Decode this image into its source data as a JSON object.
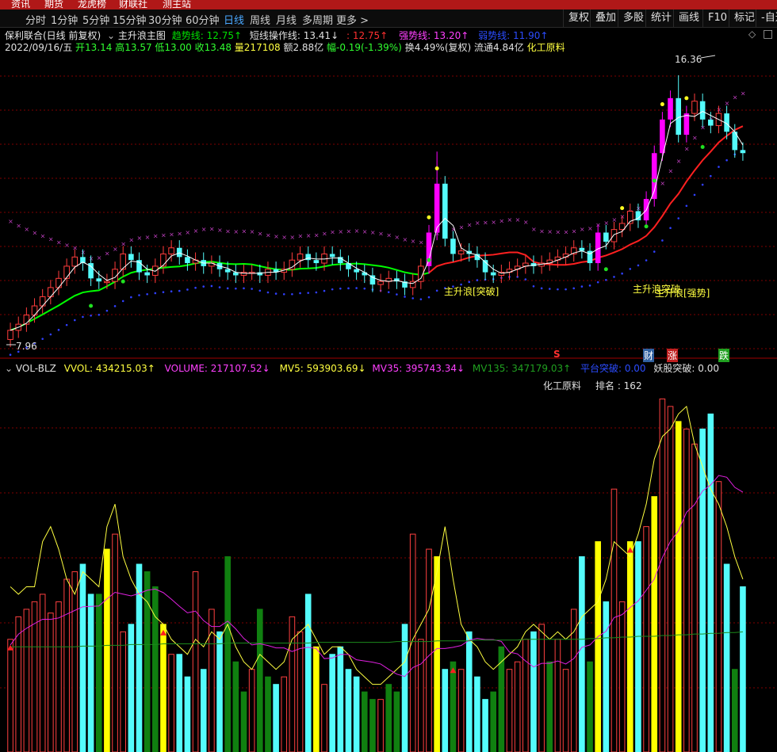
{
  "top_nav": [
    "资讯",
    "期货",
    "龙虎榜",
    "财联社",
    "测主站"
  ],
  "periods": [
    "分时",
    "1分钟",
    "5分钟",
    "15分钟",
    "30分钟",
    "60分钟",
    "日线",
    "周线",
    "月线",
    "多周期",
    "更多 >"
  ],
  "active_period": "日线",
  "right_tools": [
    "复权",
    "叠加",
    "多股",
    "统计",
    "画线",
    "F10",
    "标记",
    "-自选"
  ],
  "header": {
    "stock": "保利联合(日线 前复权)",
    "indicator": "主升浪主图",
    "trend_line": "趋势线: 12.75↑",
    "short_line": "短线操作线: 13.41↓",
    "short_val": ": 12.75↑",
    "strong_line": "强势线: 13.20↑",
    "weak_line": "弱势线: 11.90↑"
  },
  "quote": {
    "date": "2022/09/16/五",
    "open": "开13.14",
    "high": "高13.57",
    "low": "低13.00",
    "close": "收13.48",
    "volume": "量217108",
    "amount": "额2.88亿",
    "change": "幅-0.19(-1.39%)",
    "turnover": "换4.49%(复权)",
    "float": "流通4.84亿",
    "industry": "化工原料"
  },
  "price_annotations": {
    "high": "16.36",
    "low": "7.96",
    "breakout1": "主升浪[突破]",
    "breakout2": "主升浪突破",
    "strong": "主升浪[强势]",
    "mark_s": "S",
    "mark_cai": "财",
    "mark_zhang": "涨",
    "mark_die": "跌"
  },
  "volume_header": {
    "name": "VOL-BLZ",
    "vvol": "VVOL: 434215.03↑",
    "volume": "VOLUME: 217107.52↓",
    "mv5": "MV5: 593903.69↓",
    "mv35": "MV35: 395743.34↓",
    "mv135": "MV135: 347179.03↑",
    "platform": "平台突破: 0.00",
    "demon": "妖股突破: 0.00"
  },
  "sector": {
    "name": "化工原料",
    "rank": "排名 : 162"
  },
  "colors": {
    "up": "#ff3c3c",
    "down": "#54fcfc",
    "magenta": "#ff00ff",
    "yellow": "#ffff00",
    "trend_green": "#00ff00",
    "trend_red": "#ff2020",
    "grid": "#800000"
  },
  "chart_data": {
    "type": "candlestick",
    "ylim": [
      7.5,
      17.2
    ],
    "close": [
      8.1,
      8.3,
      8.6,
      8.9,
      9.2,
      9.5,
      9.8,
      10.2,
      10.5,
      10.3,
      9.8,
      9.7,
      9.7,
      10.1,
      10.6,
      10.4,
      10.0,
      9.9,
      10.2,
      10.6,
      10.8,
      10.5,
      10.3,
      10.4,
      10.2,
      10.3,
      10.1,
      10.0,
      9.9,
      10.0,
      10.0,
      9.9,
      10.1,
      10.0,
      10.1,
      10.4,
      10.6,
      10.4,
      10.3,
      10.6,
      10.5,
      10.3,
      10.1,
      10.0,
      9.9,
      9.6,
      9.7,
      9.8,
      9.7,
      9.5,
      9.7,
      10.2,
      11.3,
      12.9,
      11.1,
      10.6,
      10.7,
      10.6,
      10.4,
      10.0,
      9.9,
      10.0,
      10.1,
      10.2,
      10.3,
      10.2,
      10.3,
      10.4,
      10.5,
      10.6,
      10.8,
      10.7,
      10.3,
      11.3,
      11.0,
      11.4,
      11.6,
      12.0,
      11.7,
      12.4,
      13.9,
      15.0,
      15.7,
      14.5,
      15.2,
      15.6,
      15.0,
      14.8,
      15.2,
      14.6,
      14.0,
      13.9
    ],
    "volume": [
      150,
      180,
      190,
      200,
      210,
      185,
      200,
      230,
      240,
      250,
      210,
      210,
      270,
      290,
      160,
      170,
      250,
      240,
      220,
      170,
      130,
      130,
      100,
      240,
      110,
      190,
      160,
      260,
      120,
      80,
      110,
      190,
      100,
      90,
      100,
      180,
      160,
      210,
      140,
      90,
      130,
      140,
      110,
      100,
      80,
      70,
      70,
      90,
      80,
      170,
      290,
      150,
      270,
      260,
      110,
      120,
      110,
      160,
      100,
      70,
      80,
      140,
      110,
      120,
      150,
      160,
      170,
      120,
      150,
      110,
      190,
      260,
      120,
      280,
      200,
      350,
      200,
      280,
      280,
      300,
      340,
      470,
      460,
      440,
      430,
      410,
      430,
      450,
      360,
      250,
      110,
      220
    ],
    "vvol_line": [
      220,
      210,
      220,
      220,
      280,
      300,
      270,
      230,
      210,
      240,
      230,
      220,
      300,
      330,
      260,
      230,
      210,
      200,
      180,
      170,
      150,
      140,
      130,
      150,
      140,
      160,
      150,
      170,
      140,
      120,
      110,
      130,
      120,
      110,
      120,
      150,
      160,
      170,
      150,
      130,
      140,
      140,
      130,
      110,
      100,
      90,
      90,
      100,
      110,
      120,
      150,
      170,
      190,
      240,
      300,
      230,
      170,
      150,
      140,
      120,
      110,
      120,
      130,
      140,
      160,
      170,
      160,
      150,
      160,
      150,
      160,
      180,
      190,
      200,
      230,
      280,
      270,
      260,
      290,
      330,
      390,
      420,
      430,
      450,
      460,
      410,
      380,
      350,
      330,
      300,
      260,
      230
    ],
    "mv135_line": [
      140,
      140,
      140,
      140,
      140,
      140,
      140,
      140,
      140,
      141,
      141,
      141,
      142,
      142,
      142,
      143,
      143,
      143,
      143,
      144,
      144,
      144,
      144,
      144,
      144,
      144,
      144,
      145,
      145,
      145,
      145,
      145,
      145,
      145,
      145,
      145,
      145,
      145,
      146,
      146,
      146,
      146,
      146,
      146,
      146,
      146,
      146,
      146,
      147,
      147,
      147,
      147,
      147,
      148,
      148,
      148,
      148,
      148,
      149,
      149,
      149,
      149,
      149,
      149,
      150,
      150,
      150,
      150,
      150,
      150,
      150,
      150,
      151,
      151,
      152,
      152,
      153,
      153,
      154,
      154,
      154,
      155,
      155,
      156,
      156,
      157,
      157,
      158,
      158,
      159,
      159,
      160
    ]
  }
}
